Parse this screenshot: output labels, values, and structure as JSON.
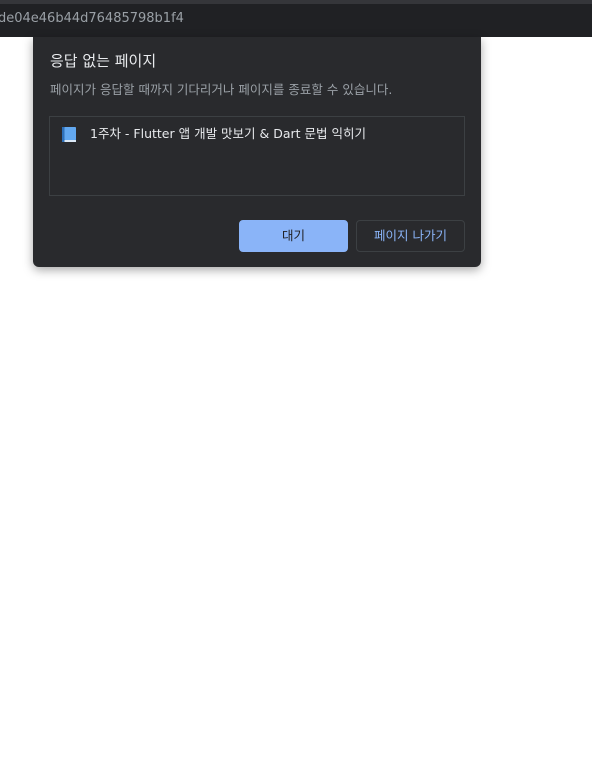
{
  "browser": {
    "url_text": "de04e46b44d76485798b1f4"
  },
  "dialog": {
    "title": "응답 없는 페이지",
    "description": "페이지가 응답할 때까지 기다리거나 페이지를 종료할 수 있습니다.",
    "pages": [
      {
        "icon": "book-icon",
        "label": "1주차 - Flutter 앱 개발 맛보기 & Dart 문법 익히기"
      }
    ],
    "buttons": {
      "wait_label": "대기",
      "exit_label": "페이지 나가기"
    }
  },
  "colors": {
    "dialog_bg": "#292a2d",
    "primary_button": "#8ab4f8",
    "text_primary": "#e8eaed",
    "text_secondary": "#9aa0a6"
  }
}
